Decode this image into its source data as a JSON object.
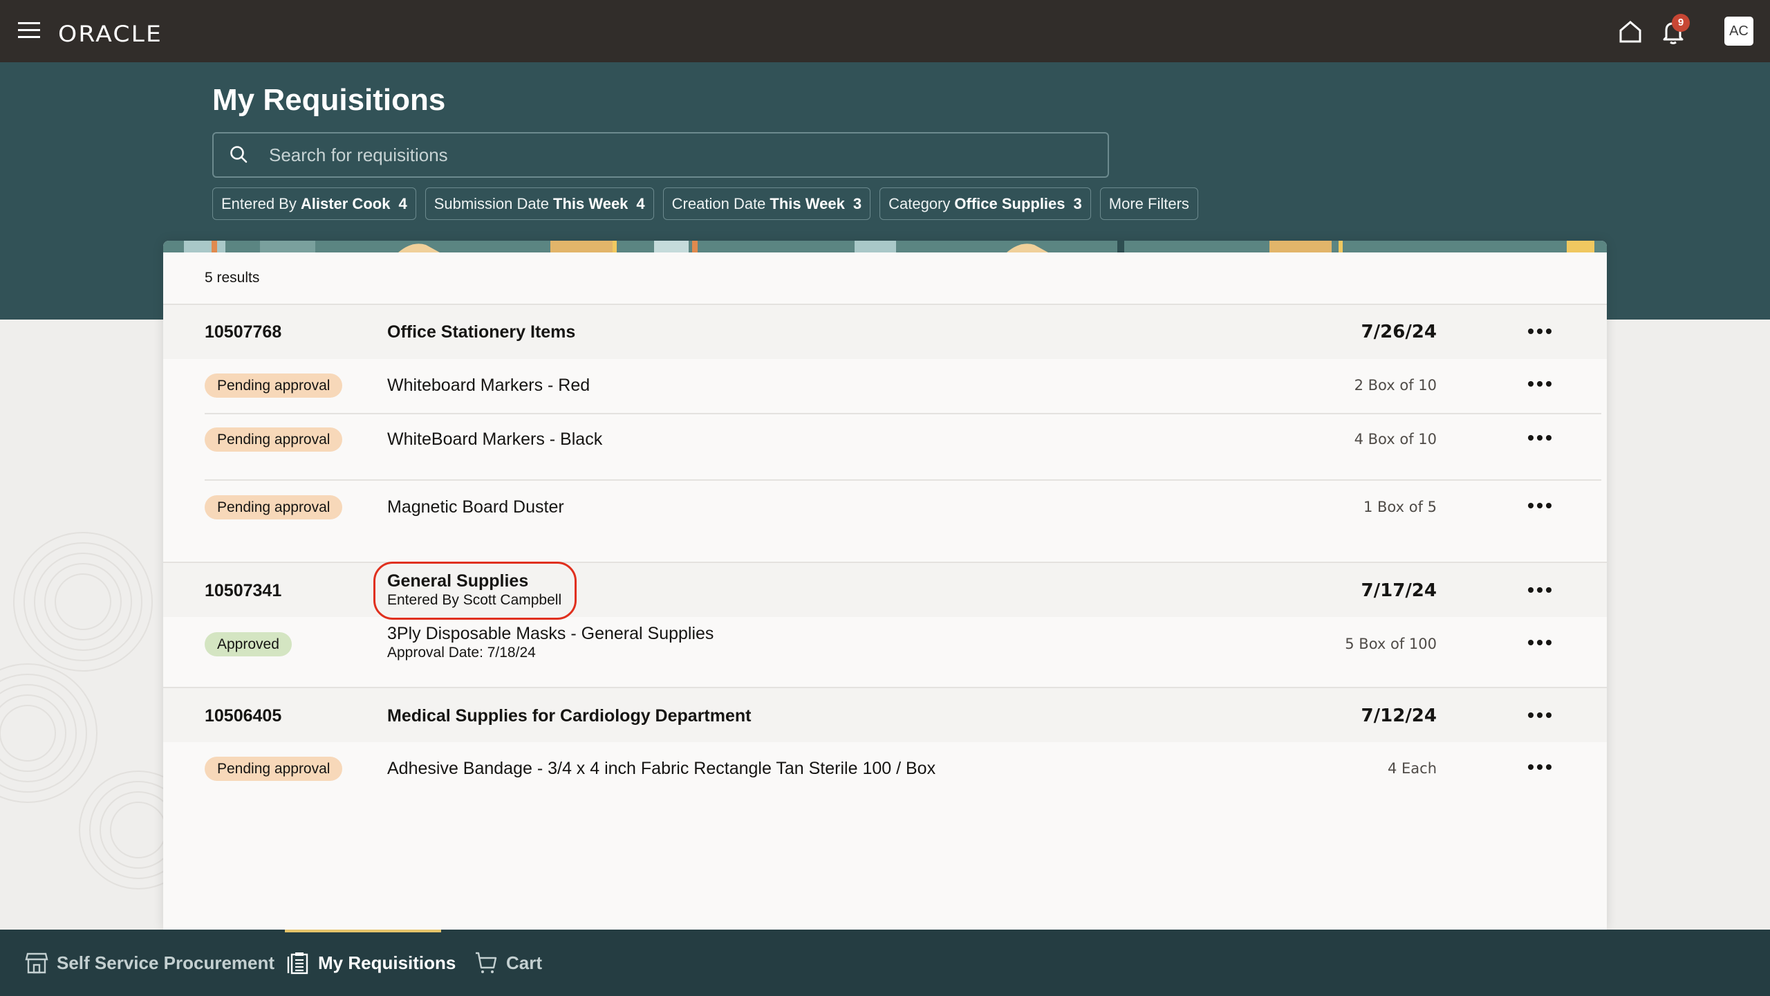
{
  "topbar": {
    "brand": "ORACLE",
    "notification_count": "9",
    "avatar_initials": "AC"
  },
  "header": {
    "title": "My Requisitions",
    "search_placeholder": "Search for requisitions",
    "search_value": "",
    "filters": [
      {
        "label": "Entered By",
        "value": "Alister Cook",
        "count": "4"
      },
      {
        "label": "Submission Date",
        "value": "This Week",
        "count": "4"
      },
      {
        "label": "Creation Date",
        "value": "This Week",
        "count": "3"
      },
      {
        "label": "Category",
        "value": "Office Supplies",
        "count": "3"
      }
    ],
    "more_filters": "More Filters"
  },
  "results": {
    "count_label": "5 results",
    "requisitions": [
      {
        "number": "10507768",
        "title": "Office Stationery Items",
        "date": "7/26/24",
        "lines": [
          {
            "status": "Pending approval",
            "name": "Whiteboard Markers - Red",
            "qty": "2 Box of 10"
          },
          {
            "status": "Pending approval",
            "name": "WhiteBoard Markers - Black",
            "qty": "4 Box of 10"
          },
          {
            "status": "Pending approval",
            "name": "Magnetic Board Duster",
            "qty": "1 Box of 5"
          }
        ]
      },
      {
        "number": "10507341",
        "title": "General Supplies",
        "subtitle": "Entered By Scott Campbell",
        "date": "7/17/24",
        "lines": [
          {
            "status": "Approved",
            "name": "3Ply Disposable Masks - General Supplies",
            "sub": "Approval Date: 7/18/24",
            "qty": "5 Box of 100"
          }
        ]
      },
      {
        "number": "10506405",
        "title": "Medical Supplies for Cardiology Department",
        "date": "7/12/24",
        "lines": [
          {
            "status": "Pending approval",
            "name": "Adhesive Bandage - 3/4 x 4 inch Fabric Rectangle Tan Sterile 100 / Box",
            "qty": "4 Each"
          }
        ]
      }
    ]
  },
  "bottom_nav": [
    {
      "label": "Self Service Procurement",
      "icon": "store-icon",
      "active": false
    },
    {
      "label": "My Requisitions",
      "icon": "clipboard-icon",
      "active": true
    },
    {
      "label": "Cart",
      "icon": "cart-icon",
      "active": false
    }
  ],
  "colors": {
    "topbar": "#312d2a",
    "header": "#325257",
    "bottom_nav": "#253d42",
    "pending": "#f7d8b9",
    "approved": "#d4e5c2",
    "badge": "#c74634",
    "nav_indicator": "#e5c46a",
    "highlight": "#e0301e"
  }
}
